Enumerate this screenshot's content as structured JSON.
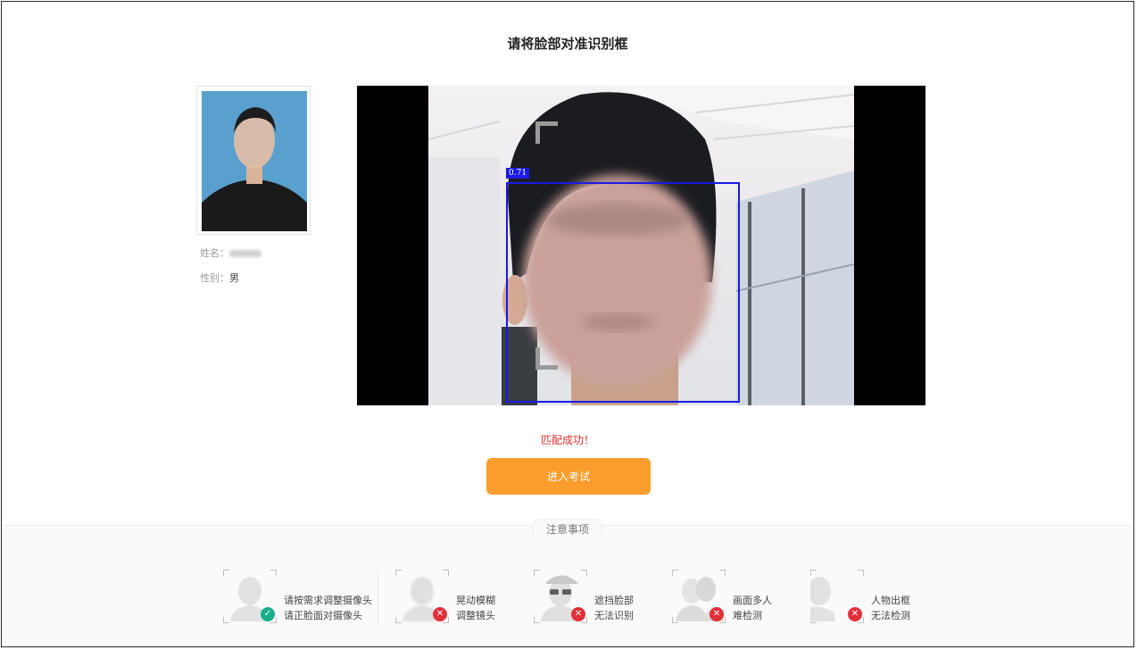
{
  "page": {
    "title": "请将脸部对准识别框"
  },
  "profile": {
    "name_label": "姓名：",
    "gender_label": "性别：",
    "gender_value": "男"
  },
  "camera": {
    "confidence": "0.71"
  },
  "status": {
    "message": "匹配成功！",
    "color": "#e0302b"
  },
  "actions": {
    "enter_exam_label": "进入考试",
    "accent": "#fb9d2c"
  },
  "notes": {
    "title": "注意事项",
    "tips": [
      {
        "icon": "person-ok-icon",
        "status": "ok",
        "line1": "请按需求调整摄像头",
        "line2": "请正脸面对摄像头"
      },
      {
        "icon": "person-blur-icon",
        "status": "error",
        "line1": "晃动模糊",
        "line2": "调整镜头"
      },
      {
        "icon": "person-occluded-icon",
        "status": "error",
        "line1": "遮挡脸部",
        "line2": "无法识别"
      },
      {
        "icon": "multiple-people-icon",
        "status": "error",
        "line1": "画面多人",
        "line2": "难检测"
      },
      {
        "icon": "person-out-of-frame-icon",
        "status": "error",
        "line1": "人物出框",
        "line2": "无法检测"
      }
    ]
  }
}
